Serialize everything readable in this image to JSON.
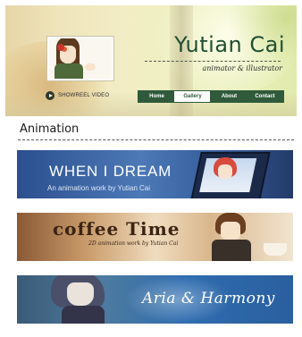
{
  "header": {
    "name": "Yutian Cai",
    "tagline": "animator & illustrator",
    "showreel_label": "SHOWREEL VIDEO"
  },
  "nav": {
    "items": [
      {
        "label": "Home"
      },
      {
        "label": "Gallery"
      },
      {
        "label": "About"
      },
      {
        "label": "Contact"
      }
    ],
    "active": "Gallery"
  },
  "section": {
    "title": "Animation"
  },
  "banners": [
    {
      "title": "WHEN I DREAM",
      "subtitle": "An animation work by Yutian Cai"
    },
    {
      "title": "coffee Time",
      "subtitle": "2D animation work by Yutian Cai"
    },
    {
      "title": "Aria & Harmony"
    }
  ],
  "colors": {
    "accent_green": "#2f5a3b",
    "name_green": "#1f4f33"
  },
  "icons": {
    "play": "play-icon"
  }
}
